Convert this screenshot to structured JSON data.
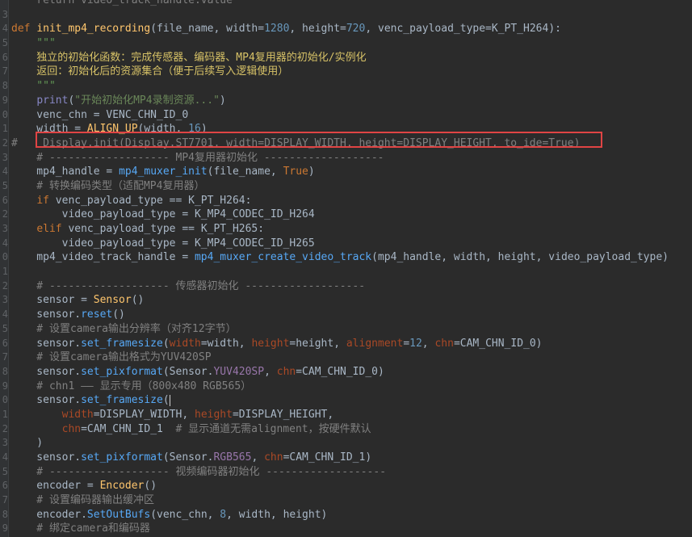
{
  "editor": {
    "lines": [
      {
        "n": "",
        "segs": [
          [
            "    return video_track_handle.value",
            "t-cmt"
          ]
        ]
      },
      {
        "n": "3",
        "segs": []
      },
      {
        "n": "4",
        "segs": [
          [
            "def ",
            "t-keyword"
          ],
          [
            "init_mp4_recording",
            "t-func"
          ],
          [
            "(file_name, width=",
            "t-default"
          ],
          [
            "1280",
            "t-num"
          ],
          [
            ", height=",
            "t-default"
          ],
          [
            "720",
            "t-num"
          ],
          [
            ", venc_payload_type=K_PT_H264):",
            "t-default"
          ]
        ]
      },
      {
        "n": "5",
        "segs": [
          [
            "    \"\"\"",
            "t-doc"
          ]
        ]
      },
      {
        "n": "6",
        "segs": [
          [
            "    独立的初始化函数：完成传感器、编码器、MP4复用器的初始化/实例化",
            "t-doc-cn"
          ]
        ]
      },
      {
        "n": "7",
        "segs": [
          [
            "    返回：初始化后的资源集合（便于后续写入逻辑使用）",
            "t-doc-cn"
          ]
        ]
      },
      {
        "n": "8",
        "segs": [
          [
            "    \"\"\"",
            "t-doc"
          ]
        ]
      },
      {
        "n": "9",
        "segs": [
          [
            "    ",
            "t-default"
          ],
          [
            "print",
            "t-builtin"
          ],
          [
            "(",
            "t-default"
          ],
          [
            "\"开始初始化MP4录制资源...\"",
            "t-string"
          ],
          [
            ")",
            "t-default"
          ]
        ]
      },
      {
        "n": "0",
        "segs": [
          [
            "    venc_chn = VENC_CHN_ID_0",
            "t-default"
          ]
        ]
      },
      {
        "n": "1",
        "segs": [
          [
            "    width = ",
            "t-default"
          ],
          [
            "ALIGN_UP",
            "t-func"
          ],
          [
            "(width, ",
            "t-default"
          ],
          [
            "16",
            "t-num"
          ],
          [
            ")",
            "t-default"
          ]
        ]
      },
      {
        "n": "2",
        "segs": [
          [
            "#    Display.init(Display.ST7701, width=DISPLAY_WIDTH, height=DISPLAY_HEIGHT, to_ide=True)",
            "t-cmt"
          ]
        ]
      },
      {
        "n": "3",
        "segs": [
          [
            "    # ------------------- MP4复用器初始化 -------------------",
            "t-cmt"
          ]
        ]
      },
      {
        "n": "4",
        "segs": [
          [
            "    mp4_handle = ",
            "t-default"
          ],
          [
            "mp4_muxer_init",
            "t-method"
          ],
          [
            "(file_name, ",
            "t-default"
          ],
          [
            "True",
            "t-true"
          ],
          [
            ")",
            "t-default"
          ]
        ]
      },
      {
        "n": "5",
        "segs": [
          [
            "    # 转换编码类型（适配MP4复用器）",
            "t-cmt"
          ]
        ]
      },
      {
        "n": "6",
        "segs": [
          [
            "    ",
            "t-default"
          ],
          [
            "if ",
            "t-keyword"
          ],
          [
            "venc_payload_type == K_PT_H264:",
            "t-default"
          ]
        ]
      },
      {
        "n": "2",
        "segs": [
          [
            "        video_payload_type = K_MP4_CODEC_ID_H264",
            "t-default"
          ]
        ]
      },
      {
        "n": "3",
        "segs": [
          [
            "    ",
            "t-default"
          ],
          [
            "elif ",
            "t-keyword"
          ],
          [
            "venc_payload_type == K_PT_H265:",
            "t-default"
          ]
        ]
      },
      {
        "n": "4",
        "segs": [
          [
            "        video_payload_type = K_MP4_CODEC_ID_H265",
            "t-default"
          ]
        ]
      },
      {
        "n": "0",
        "segs": [
          [
            "    mp4_video_track_handle = ",
            "t-default"
          ],
          [
            "mp4_muxer_create_video_track",
            "t-method"
          ],
          [
            "(mp4_handle, width, height, video_payload_type)",
            "t-default"
          ]
        ]
      },
      {
        "n": "1",
        "segs": []
      },
      {
        "n": "2",
        "segs": [
          [
            "    # ------------------- 传感器初始化 -------------------",
            "t-cmt"
          ]
        ]
      },
      {
        "n": "3",
        "segs": [
          [
            "    sensor = ",
            "t-default"
          ],
          [
            "Sensor",
            "t-func"
          ],
          [
            "()",
            "t-default"
          ]
        ]
      },
      {
        "n": "4",
        "segs": [
          [
            "    sensor.",
            "t-default"
          ],
          [
            "reset",
            "t-method"
          ],
          [
            "()",
            "t-default"
          ]
        ]
      },
      {
        "n": "5",
        "segs": [
          [
            "    # 设置camera输出分辨率（对齐12字节）",
            "t-cmt"
          ]
        ]
      },
      {
        "n": "6",
        "segs": [
          [
            "    sensor.",
            "t-default"
          ],
          [
            "set_framesize",
            "t-method"
          ],
          [
            "(",
            "t-default"
          ],
          [
            "width",
            "t-kwarg"
          ],
          [
            "=width, ",
            "t-default"
          ],
          [
            "height",
            "t-kwarg"
          ],
          [
            "=height, ",
            "t-default"
          ],
          [
            "alignment",
            "t-kwarg"
          ],
          [
            "=",
            "t-default"
          ],
          [
            "12",
            "t-num"
          ],
          [
            ", ",
            "t-default"
          ],
          [
            "chn",
            "t-kwarg"
          ],
          [
            "=CAM_CHN_ID_0)",
            "t-default"
          ]
        ]
      },
      {
        "n": "7",
        "segs": [
          [
            "    # 设置camera输出格式为YUV420SP",
            "t-cmt"
          ]
        ]
      },
      {
        "n": "8",
        "segs": [
          [
            "    sensor.",
            "t-default"
          ],
          [
            "set_pixformat",
            "t-method"
          ],
          [
            "(Sensor.",
            "t-default"
          ],
          [
            "YUV420SP",
            "t-attr"
          ],
          [
            ", ",
            "t-default"
          ],
          [
            "chn",
            "t-kwarg"
          ],
          [
            "=CAM_CHN_ID_0)",
            "t-default"
          ]
        ]
      },
      {
        "n": "9",
        "segs": [
          [
            "    # chn1 —— 显示专用（800x480 RGB565）",
            "t-cmt"
          ]
        ]
      },
      {
        "n": "0",
        "segs": [
          [
            "    sensor.",
            "t-default"
          ],
          [
            "set_framesize",
            "t-method"
          ],
          [
            "(",
            "t-default"
          ]
        ],
        "caret": true
      },
      {
        "n": "1",
        "segs": [
          [
            "        ",
            "t-default"
          ],
          [
            "width",
            "t-kwarg"
          ],
          [
            "=DISPLAY_WIDTH, ",
            "t-default"
          ],
          [
            "height",
            "t-kwarg"
          ],
          [
            "=DISPLAY_HEIGHT,",
            "t-default"
          ]
        ]
      },
      {
        "n": "2",
        "segs": [
          [
            "        ",
            "t-default"
          ],
          [
            "chn",
            "t-kwarg"
          ],
          [
            "=CAM_CHN_ID_1  ",
            "t-default"
          ],
          [
            "# 显示通道无需alignment，按硬件默认",
            "t-cmt"
          ]
        ]
      },
      {
        "n": "3",
        "segs": [
          [
            "    )",
            "t-default"
          ]
        ]
      },
      {
        "n": "4",
        "segs": [
          [
            "    sensor.",
            "t-default"
          ],
          [
            "set_pixformat",
            "t-method"
          ],
          [
            "(Sensor.",
            "t-default"
          ],
          [
            "RGB565",
            "t-attr"
          ],
          [
            ", ",
            "t-default"
          ],
          [
            "chn",
            "t-kwarg"
          ],
          [
            "=CAM_CHN_ID_1)",
            "t-default"
          ]
        ]
      },
      {
        "n": "5",
        "segs": [
          [
            "    # ------------------- 视频编码器初始化 -------------------",
            "t-cmt"
          ]
        ]
      },
      {
        "n": "6",
        "segs": [
          [
            "    encoder = ",
            "t-default"
          ],
          [
            "Encoder",
            "t-func"
          ],
          [
            "()",
            "t-default"
          ]
        ]
      },
      {
        "n": "7",
        "segs": [
          [
            "    # 设置编码器输出缓冲区",
            "t-cmt"
          ]
        ]
      },
      {
        "n": "8",
        "segs": [
          [
            "    encoder.",
            "t-default"
          ],
          [
            "SetOutBufs",
            "t-method"
          ],
          [
            "(venc_chn, ",
            "t-default"
          ],
          [
            "8",
            "t-num"
          ],
          [
            ", width, height)",
            "t-default"
          ]
        ]
      },
      {
        "n": "9",
        "segs": [
          [
            "    # 绑定camera和编码器",
            "t-cmt"
          ]
        ]
      }
    ]
  },
  "colors": {
    "background": "#2b2b2b",
    "highlight_box": "#e04444"
  }
}
